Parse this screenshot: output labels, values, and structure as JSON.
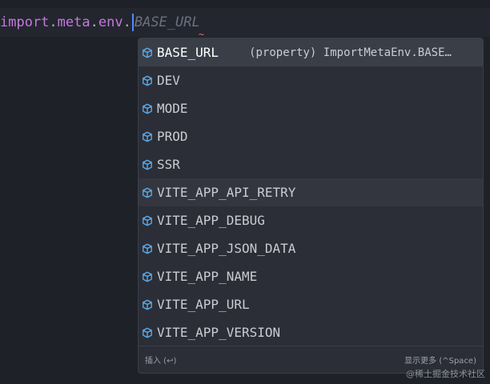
{
  "editor": {
    "code": {
      "object": "import",
      "dot1": ".",
      "meta": "meta",
      "dot2": ".",
      "env": "env",
      "dot3": ".",
      "ghost": "BASE_URL"
    }
  },
  "suggest": {
    "items": [
      {
        "label": "BASE_URL",
        "detail": "(property) ImportMetaEnv.BASE…",
        "icon": "cube-icon"
      },
      {
        "label": "DEV",
        "icon": "cube-icon"
      },
      {
        "label": "MODE",
        "icon": "cube-icon"
      },
      {
        "label": "PROD",
        "icon": "cube-icon"
      },
      {
        "label": "SSR",
        "icon": "cube-icon"
      },
      {
        "label": "VITE_APP_API_RETRY",
        "icon": "cube-icon"
      },
      {
        "label": "VITE_APP_DEBUG",
        "icon": "cube-icon"
      },
      {
        "label": "VITE_APP_JSON_DATA",
        "icon": "cube-icon"
      },
      {
        "label": "VITE_APP_NAME",
        "icon": "cube-icon"
      },
      {
        "label": "VITE_APP_URL",
        "icon": "cube-icon"
      },
      {
        "label": "VITE_APP_VERSION",
        "icon": "cube-icon"
      }
    ],
    "footer": {
      "insert_hint": "插入 (↩)",
      "more_hint": "显示更多 (^Space)"
    }
  },
  "watermark": "@稀土掘金技术社区",
  "colors": {
    "background": "#1e2128",
    "icon": "#5aa7e6",
    "cursor": "#528bff",
    "keyword": "#c678dd"
  }
}
